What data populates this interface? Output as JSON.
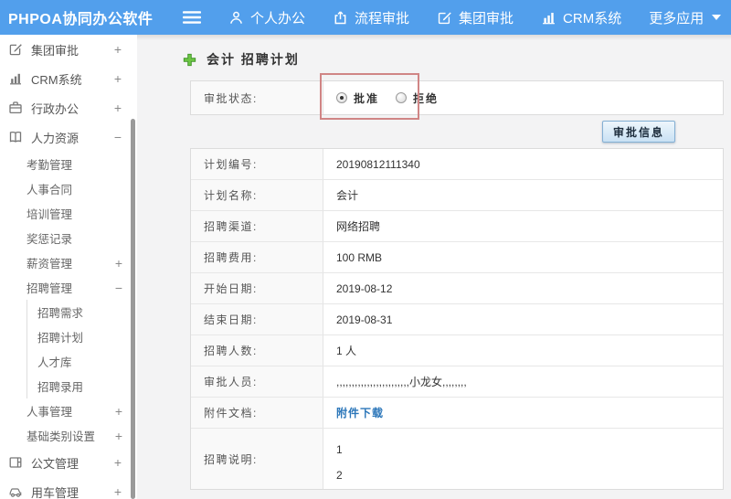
{
  "colors": {
    "topbar_bg": "#529fec",
    "link": "#2b76b9",
    "button_border": "#84b0d4",
    "annotation": "#d08585",
    "plus_green": "#61bf3e"
  },
  "topbar": {
    "logo": "PHPOA协同办公软件",
    "nav": [
      {
        "name": "personal-office",
        "label": "个人办公",
        "icon": "person-icon"
      },
      {
        "name": "process-approval",
        "label": "流程审批",
        "icon": "workflow-icon"
      },
      {
        "name": "group-approval",
        "label": "集团审批",
        "icon": "edit-icon"
      },
      {
        "name": "crm-system",
        "label": "CRM系统",
        "icon": "chart-icon"
      },
      {
        "name": "more-apps",
        "label": "更多应用",
        "trailing_icon": "caret-down-icon"
      }
    ]
  },
  "sidebar": {
    "items": [
      {
        "name": "group-approval",
        "label": "集团审批",
        "icon": "edit-icon",
        "expand": "+",
        "level": 1
      },
      {
        "name": "crm-system",
        "label": "CRM系统",
        "icon": "chart-icon",
        "expand": "+",
        "level": 1
      },
      {
        "name": "admin-office",
        "label": "行政办公",
        "icon": "briefcase-icon",
        "expand": "+",
        "level": 1
      },
      {
        "name": "human-resources",
        "label": "人力资源",
        "icon": "book-icon",
        "expand": "−",
        "level": 1
      },
      {
        "name": "attendance-mgmt",
        "label": "考勤管理",
        "level": 2
      },
      {
        "name": "hr-contract",
        "label": "人事合同",
        "level": 2
      },
      {
        "name": "training-mgmt",
        "label": "培训管理",
        "level": 2
      },
      {
        "name": "reward-records",
        "label": "奖惩记录",
        "level": 2
      },
      {
        "name": "salary-mgmt",
        "label": "薪资管理",
        "expand": "+",
        "level": 2
      },
      {
        "name": "recruit-mgmt",
        "label": "招聘管理",
        "expand": "−",
        "level": 2
      },
      {
        "name": "recruit-demand",
        "label": "招聘需求",
        "level": 3
      },
      {
        "name": "recruit-plan",
        "label": "招聘计划",
        "level": 3
      },
      {
        "name": "talent-pool",
        "label": "人才库",
        "level": 3
      },
      {
        "name": "recruit-hire",
        "label": "招聘录用",
        "level": 3
      },
      {
        "name": "personnel-mgmt",
        "label": "人事管理",
        "expand": "+",
        "level": 2
      },
      {
        "name": "base-category",
        "label": "基础类别设置",
        "expand": "+",
        "level": 2
      },
      {
        "name": "document-mgmt",
        "label": "公文管理",
        "icon": "doc-icon",
        "expand": "+",
        "level": 1
      },
      {
        "name": "vehicle-mgmt",
        "label": "用车管理",
        "icon": "car-icon",
        "expand": "+",
        "level": 1
      }
    ]
  },
  "main": {
    "title": "会计 招聘计划",
    "title_icon": "add-icon",
    "approval": {
      "label": "审批状态:",
      "options": [
        {
          "label": "批准",
          "checked": true
        },
        {
          "label": "拒绝",
          "checked": false
        }
      ]
    },
    "approval_info_button": "审批信息",
    "rows": [
      {
        "name": "plan-number",
        "label": "计划编号:",
        "type": "text",
        "value": "20190812111340"
      },
      {
        "name": "plan-name",
        "label": "计划名称:",
        "type": "text",
        "value": "会计"
      },
      {
        "name": "recruit-channel",
        "label": "招聘渠道:",
        "type": "text",
        "value": "网络招聘"
      },
      {
        "name": "recruit-cost",
        "label": "招聘费用:",
        "type": "text",
        "value": "100 RMB"
      },
      {
        "name": "start-date",
        "label": "开始日期:",
        "type": "text",
        "value": "2019-08-12"
      },
      {
        "name": "end-date",
        "label": "结束日期:",
        "type": "text",
        "value": "2019-08-31"
      },
      {
        "name": "recruit-count",
        "label": "招聘人数:",
        "type": "text",
        "value": "1 人"
      },
      {
        "name": "approvers",
        "label": "审批人员:",
        "type": "text",
        "value": ",,,,,,,,,,,,,,,,,,,,,,,,小龙女,,,,,,,,"
      },
      {
        "name": "attachment",
        "label": "附件文档:",
        "type": "link",
        "value": "附件下载"
      },
      {
        "name": "recruit-note",
        "label": "招聘说明:",
        "type": "lines",
        "lines": [
          "1",
          "2"
        ]
      }
    ]
  }
}
